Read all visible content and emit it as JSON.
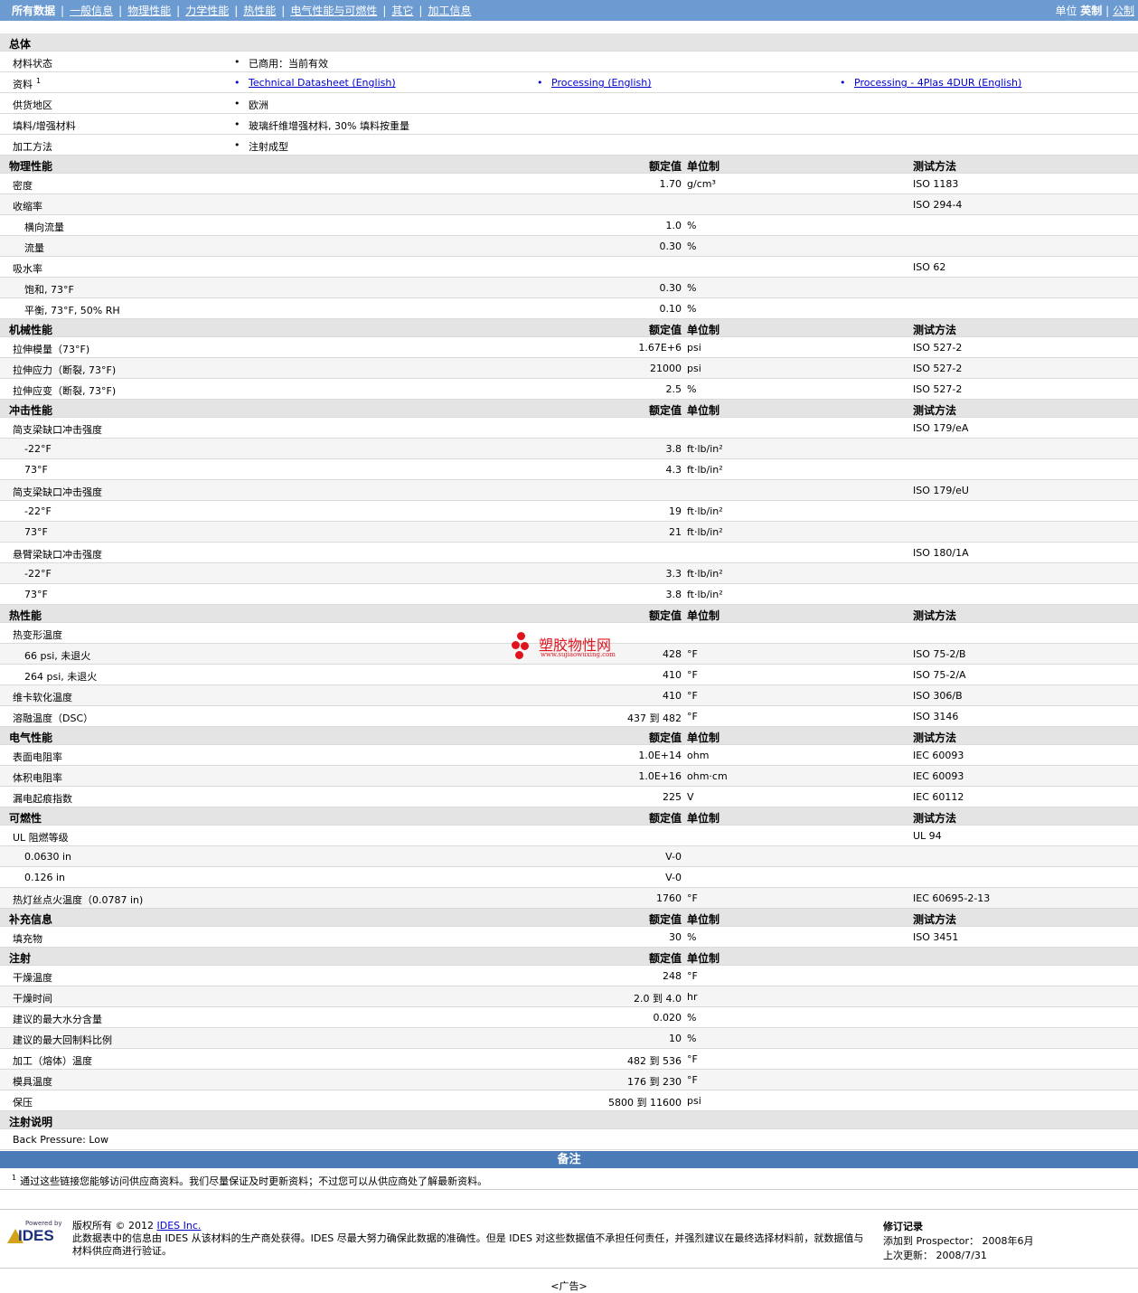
{
  "nav": {
    "items": [
      "所有数据",
      "一般信息",
      "物理性能",
      "力学性能",
      "热性能",
      "电气性能与可燃性",
      "其它",
      "加工信息"
    ],
    "units_label": "单位",
    "unit_english": "英制",
    "unit_metric": "公制"
  },
  "general": {
    "title": "总体",
    "material_status_label": "材料状态",
    "material_status_value": "已商用：当前有效",
    "docs_label": "资料",
    "docs_sup": "1",
    "docs": [
      "Technical Datasheet (English)",
      "Processing (English)",
      "Processing - 4Plas 4DUR (English)"
    ],
    "region_label": "供货地区",
    "region_value": "欧洲",
    "filler_label": "填料/增强材料",
    "filler_value": "玻璃纤维增强材料, 30% 填料按重量",
    "method_label": "加工方法",
    "method_value": "注射成型"
  },
  "headers": {
    "nominal": "额定值",
    "unit": "单位制",
    "test": "测试方法"
  },
  "sections": [
    {
      "title": "物理性能",
      "show_test": true,
      "rows": [
        {
          "label": "密度",
          "value": "1.70",
          "unit": "g/cm³",
          "test": "ISO 1183"
        },
        {
          "label": "收缩率",
          "value": "",
          "unit": "",
          "test": "ISO 294-4"
        },
        {
          "label": "横向流量",
          "value": "1.0",
          "unit": "%",
          "test": "",
          "sub": true
        },
        {
          "label": "流量",
          "value": "0.30",
          "unit": "%",
          "test": "",
          "sub": true
        },
        {
          "label": "吸水率",
          "value": "",
          "unit": "",
          "test": "ISO 62"
        },
        {
          "label": "饱和, 73°F",
          "value": "0.30",
          "unit": "%",
          "test": "",
          "sub": true
        },
        {
          "label": "平衡, 73°F, 50% RH",
          "value": "0.10",
          "unit": "%",
          "test": "",
          "sub": true
        }
      ]
    },
    {
      "title": "机械性能",
      "show_test": true,
      "rows": [
        {
          "label": "拉伸模量（73°F)",
          "value": "1.67E+6",
          "unit": "psi",
          "test": "ISO 527-2"
        },
        {
          "label": "拉伸应力（断裂, 73°F)",
          "value": "21000",
          "unit": "psi",
          "test": "ISO 527-2"
        },
        {
          "label": "拉伸应变（断裂, 73°F)",
          "value": "2.5",
          "unit": "%",
          "test": "ISO 527-2"
        }
      ]
    },
    {
      "title": "冲击性能",
      "show_test": true,
      "rows": [
        {
          "label": "简支梁缺口冲击强度",
          "value": "",
          "unit": "",
          "test": "ISO 179/eA"
        },
        {
          "label": "-22°F",
          "value": "3.8",
          "unit": "ft·lb/in²",
          "test": "",
          "sub": true
        },
        {
          "label": "73°F",
          "value": "4.3",
          "unit": "ft·lb/in²",
          "test": "",
          "sub": true
        },
        {
          "label": "简支梁缺口冲击强度",
          "value": "",
          "unit": "",
          "test": "ISO 179/eU"
        },
        {
          "label": "-22°F",
          "value": "19",
          "unit": "ft·lb/in²",
          "test": "",
          "sub": true
        },
        {
          "label": "73°F",
          "value": "21",
          "unit": "ft·lb/in²",
          "test": "",
          "sub": true
        },
        {
          "label": "悬臂梁缺口冲击强度",
          "value": "",
          "unit": "",
          "test": "ISO 180/1A"
        },
        {
          "label": "-22°F",
          "value": "3.3",
          "unit": "ft·lb/in²",
          "test": "",
          "sub": true
        },
        {
          "label": "73°F",
          "value": "3.8",
          "unit": "ft·lb/in²",
          "test": "",
          "sub": true
        }
      ]
    },
    {
      "title": "热性能",
      "show_test": true,
      "rows": [
        {
          "label": "热变形温度",
          "value": "",
          "unit": "",
          "test": ""
        },
        {
          "label": "66 psi, 未退火",
          "value": "428",
          "unit": "°F",
          "test": "ISO 75-2/B",
          "sub": true
        },
        {
          "label": "264 psi, 未退火",
          "value": "410",
          "unit": "°F",
          "test": "ISO 75-2/A",
          "sub": true
        },
        {
          "label": "维卡软化温度",
          "value": "410",
          "unit": "°F",
          "test": "ISO 306/B"
        },
        {
          "label": "溶融温度（DSC）",
          "value": "437 到  482",
          "unit": "°F",
          "test": "ISO 3146"
        }
      ]
    },
    {
      "title": "电气性能",
      "show_test": true,
      "rows": [
        {
          "label": "表面电阻率",
          "value": "1.0E+14",
          "unit": "ohm",
          "test": "IEC 60093"
        },
        {
          "label": "体积电阻率",
          "value": "1.0E+16",
          "unit": "ohm·cm",
          "test": "IEC 60093"
        },
        {
          "label": "漏电起痕指数",
          "value": "225",
          "unit": "V",
          "test": "IEC 60112"
        }
      ]
    },
    {
      "title": "可燃性",
      "show_test": true,
      "rows": [
        {
          "label": "UL 阻燃等级",
          "value": "",
          "unit": "",
          "test": "UL 94"
        },
        {
          "label": "0.0630 in",
          "value": "V-0",
          "unit": "",
          "test": "",
          "sub": true
        },
        {
          "label": "0.126 in",
          "value": "V-0",
          "unit": "",
          "test": "",
          "sub": true
        },
        {
          "label": "热灯丝点火温度（0.0787 in)",
          "value": "1760",
          "unit": "°F",
          "test": "IEC 60695-2-13"
        }
      ]
    },
    {
      "title": "补充信息",
      "show_test": true,
      "rows": [
        {
          "label": "填充物",
          "value": "30",
          "unit": "%",
          "test": "ISO 3451"
        }
      ]
    },
    {
      "title": "注射",
      "show_test": false,
      "rows": [
        {
          "label": "干燥温度",
          "value": "248",
          "unit": "°F",
          "test": ""
        },
        {
          "label": "干燥时间",
          "value": "2.0 到  4.0",
          "unit": "hr",
          "test": ""
        },
        {
          "label": "建议的最大水分含量",
          "value": "0.020",
          "unit": "%",
          "test": ""
        },
        {
          "label": "建议的最大回制料比例",
          "value": "10",
          "unit": "%",
          "test": ""
        },
        {
          "label": "加工（熔体）温度",
          "value": "482 到  536",
          "unit": "°F",
          "test": ""
        },
        {
          "label": "模具温度",
          "value": "176 到  230",
          "unit": "°F",
          "test": ""
        },
        {
          "label": "保压",
          "value": "5800 到  11600",
          "unit": "psi",
          "test": ""
        }
      ]
    }
  ],
  "injection_notes": {
    "title": "注射说明",
    "text": "Back Pressure: Low"
  },
  "notes": {
    "title": "备注",
    "footnote_sup": "1",
    "footnote": "通过这些链接您能够访问供应商资料。我们尽量保证及时更新资料；不过您可以从供应商处了解最新资料。"
  },
  "footer": {
    "powered_by": "Powered by",
    "logo_text": "IDES",
    "copyright_prefix": "版权所有 © 2012 ",
    "copyright_link": "IDES Inc.",
    "disclaimer": "此数据表中的信息由 IDES 从该材料的生产商处获得。IDES 尽最大努力确保此数据的准确性。但是 IDES 对这些数据值不承担任何责任，并强烈建议在最终选择材料前，就数据值与材料供应商进行验证。",
    "revision_title": "修订记录",
    "added_label": "添加到 Prospector：",
    "added_value": "2008年6月",
    "updated_label": "上次更新：",
    "updated_value": "2008/7/31",
    "ad": "<广告>"
  },
  "watermark": {
    "name": "塑胶物性网",
    "url": "www.sujiaowuxing.com"
  },
  "colors": {
    "nav_bg": "#6b9bd1",
    "notes_bg": "#4a7bb7",
    "section_bg": "#e4e4e4",
    "link": "#0000cc",
    "watermark": "#e0141e"
  }
}
